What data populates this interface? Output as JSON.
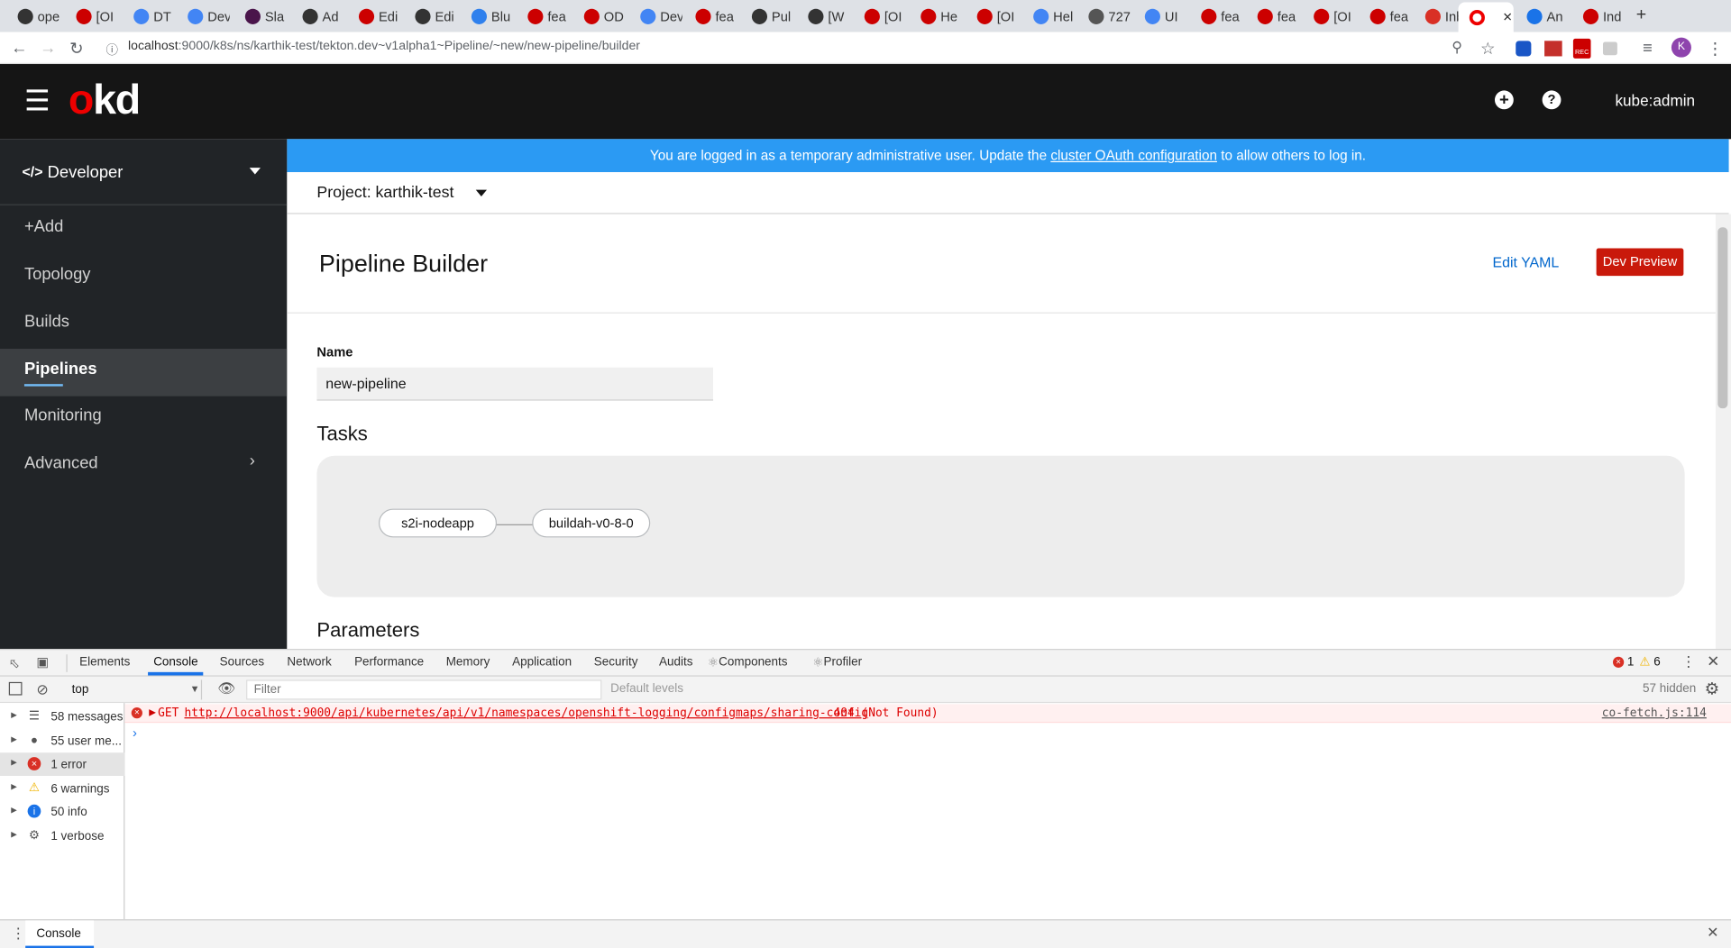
{
  "browser": {
    "tabs": [
      "ope",
      "[OI",
      "DT",
      "Dev",
      "Sla",
      "Ad",
      "Edi",
      "Edi",
      "Blu",
      "fea",
      "OD",
      "Dev",
      "fea",
      "Pul",
      "[W",
      "[OI",
      "He",
      "[OI",
      "Hel",
      "727",
      "UI",
      "fea",
      "fea",
      "[OI",
      "fea",
      "Inb",
      "",
      "An",
      "Ind"
    ],
    "url_host": "localhost",
    "url_path": ":9000/k8s/ns/karthik-test/tekton.dev~v1alpha1~Pipeline/~new/new-pipeline/builder",
    "profile_initial": "K",
    "rec_label": "REC"
  },
  "masthead": {
    "logo_o": "o",
    "logo_rest": "kd",
    "user": "kube:admin"
  },
  "sidebar": {
    "perspective": "Developer",
    "items": [
      {
        "label": "+Add"
      },
      {
        "label": "Topology"
      },
      {
        "label": "Builds"
      },
      {
        "label": "Pipelines"
      },
      {
        "label": "Monitoring"
      },
      {
        "label": "Advanced"
      }
    ]
  },
  "banner": {
    "pre": "You are logged in as a temporary administrative user. Update the ",
    "link": "cluster OAuth configuration",
    "post": " to allow others to log in."
  },
  "project": {
    "label": "Project: karthik-test"
  },
  "page": {
    "title": "Pipeline Builder",
    "edit_yaml": "Edit YAML",
    "dev_preview": "Dev Preview",
    "name_label": "Name",
    "name_value": "new-pipeline",
    "tasks_heading": "Tasks",
    "params_heading": "Parameters"
  },
  "tasks": [
    "s2i-nodeapp",
    "buildah-v0-8-0"
  ],
  "devtools": {
    "tabs": [
      "Elements",
      "Console",
      "Sources",
      "Network",
      "Performance",
      "Memory",
      "Application",
      "Security",
      "Audits",
      "Components",
      "Profiler"
    ],
    "errors": "1",
    "warnings": "6",
    "context": "top",
    "filter_placeholder": "Filter",
    "levels": "Default levels",
    "hidden": "57 hidden",
    "sidebar": [
      {
        "label": "58 messages"
      },
      {
        "label": "55 user me..."
      },
      {
        "label": "1 error"
      },
      {
        "label": "6 warnings"
      },
      {
        "label": "50 info"
      },
      {
        "label": "1 verbose"
      }
    ],
    "error_line": {
      "method": "GET",
      "url": "http://localhost:9000/api/kubernetes/api/v1/namespaces/openshift-logging/configmaps/sharing-config",
      "status": "404 (Not Found)",
      "source": "co-fetch.js:114"
    },
    "drawer_tab": "Console"
  },
  "colors": {
    "masthead": "#151515",
    "sidebar": "#212427",
    "banner": "#2b9af3",
    "danger": "#c9190b",
    "link": "#0066cc"
  }
}
